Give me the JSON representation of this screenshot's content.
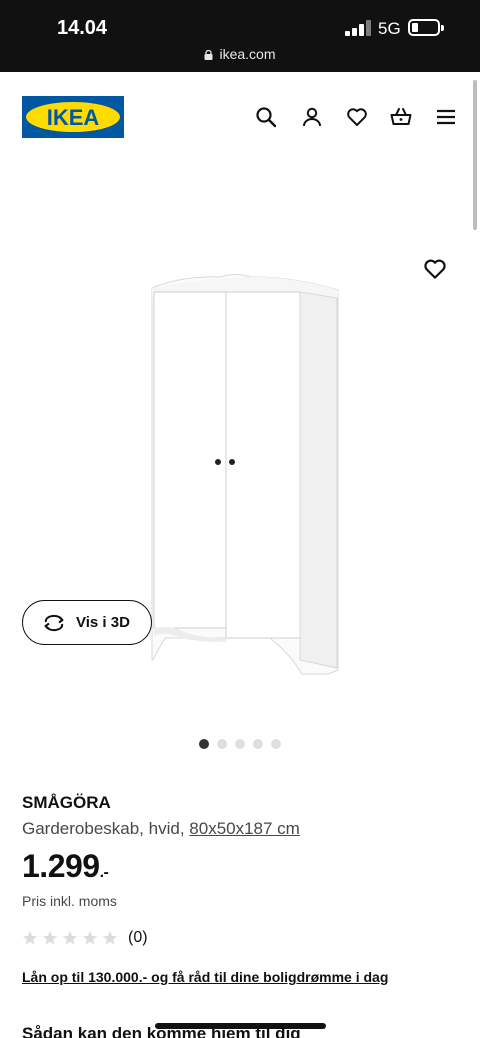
{
  "status_bar": {
    "time": "14.04",
    "network": "5G"
  },
  "browser": {
    "url": "ikea.com"
  },
  "header": {
    "logo_text": "IKEA",
    "brand_colors": {
      "blue": "#0058a3",
      "yellow": "#ffdb00"
    },
    "icons": [
      "search-icon",
      "account-icon",
      "favourites-icon",
      "basket-icon",
      "menu-icon"
    ]
  },
  "gallery": {
    "view_3d_label": "Vis i 3D",
    "slide_count": 5,
    "active_slide": 1
  },
  "product": {
    "name": "SMÅGÖRA",
    "description": "Garderobeskab, hvid,",
    "dimensions": "80x50x187 cm",
    "price": "1.299",
    "price_suffix": ".-",
    "vat_note": "Pris inkl. moms",
    "rating_stars": 0,
    "rating_max": 5,
    "review_count": "(0)",
    "loan_link": "Lån op til 130.000.- og få råd til dine boligdrømme i dag",
    "delivery_heading": "Sådan kan den komme hjem til dig"
  }
}
